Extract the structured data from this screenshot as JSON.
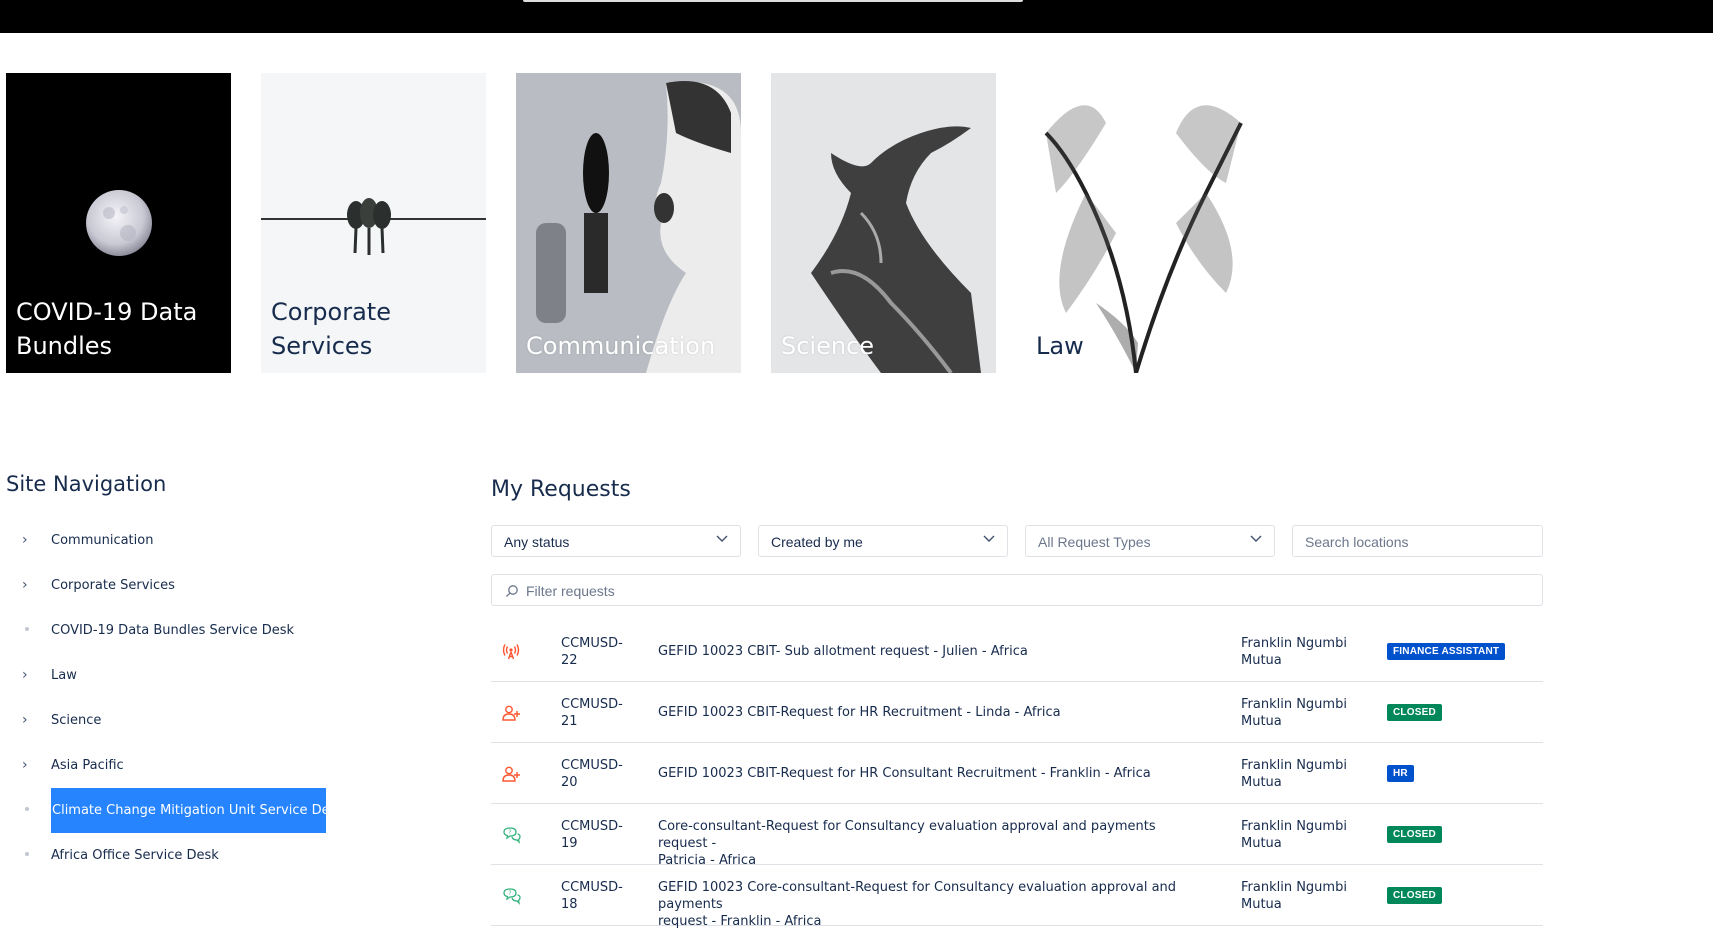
{
  "tiles": [
    {
      "label": "COVID-19 Data Bundles"
    },
    {
      "label": "Corporate Services"
    },
    {
      "label": "Communication"
    },
    {
      "label": "Science"
    },
    {
      "label": "Law"
    }
  ],
  "navigation": {
    "title": "Site Navigation",
    "items": [
      {
        "label": "Communication",
        "marker": "chevron"
      },
      {
        "label": "Corporate Services",
        "marker": "chevron"
      },
      {
        "label": "COVID-19 Data Bundles Service Desk",
        "marker": "dot"
      },
      {
        "label": "Law",
        "marker": "chevron"
      },
      {
        "label": "Science",
        "marker": "chevron"
      },
      {
        "label": "Asia Pacific",
        "marker": "chevron"
      },
      {
        "label": "Climate Change Mitigation Unit Service Desk",
        "marker": "dot",
        "active": true
      },
      {
        "label": "Africa Office Service Desk",
        "marker": "dot"
      }
    ]
  },
  "requests": {
    "title": "My Requests",
    "filters": {
      "status": "Any status",
      "created_by": "Created by me",
      "request_types": "All Request Types",
      "locations_placeholder": "Search locations",
      "filter_placeholder": "Filter requests"
    },
    "rows": [
      {
        "icon": "broadcast-icon",
        "key_a": "CCMUSD-",
        "key_b": "22",
        "summary": "GEFID 10023 CBIT- Sub allotment request - Julien - Africa",
        "reporter_a": "Franklin Ngumbi",
        "reporter_b": "Mutua",
        "status": "FINANCE ASSISTANT",
        "status_color": "#0052cc"
      },
      {
        "icon": "add-person-icon",
        "key_a": "CCMUSD-",
        "key_b": "21",
        "summary": "GEFID 10023 CBIT-Request for HR Recruitment - Linda - Africa",
        "reporter_a": "Franklin Ngumbi",
        "reporter_b": "Mutua",
        "status": "CLOSED",
        "status_color": "#00875a"
      },
      {
        "icon": "add-person-icon",
        "key_a": "CCMUSD-",
        "key_b": "20",
        "summary": "GEFID 10023 CBIT-Request for HR Consultant Recruitment - Franklin - Africa",
        "reporter_a": "Franklin Ngumbi",
        "reporter_b": "Mutua",
        "status": "HR",
        "status_color": "#0052cc"
      },
      {
        "icon": "chat-question-icon",
        "key_a": "CCMUSD-",
        "key_b": "19",
        "summary_a": "Core-consultant-Request for Consultancy evaluation approval and payments request -",
        "summary_b": "Patricia - Africa",
        "reporter_a": "Franklin Ngumbi",
        "reporter_b": "Mutua",
        "status": "CLOSED",
        "status_color": "#00875a"
      },
      {
        "icon": "chat-question-icon",
        "key_a": "CCMUSD-",
        "key_b": "18",
        "summary_a": "GEFID 10023 Core-consultant-Request for Consultancy evaluation approval and payments",
        "summary_b": "request - Franklin - Africa",
        "reporter_a": "Franklin Ngumbi",
        "reporter_b": "Mutua",
        "status": "CLOSED",
        "status_color": "#00875a"
      }
    ]
  }
}
